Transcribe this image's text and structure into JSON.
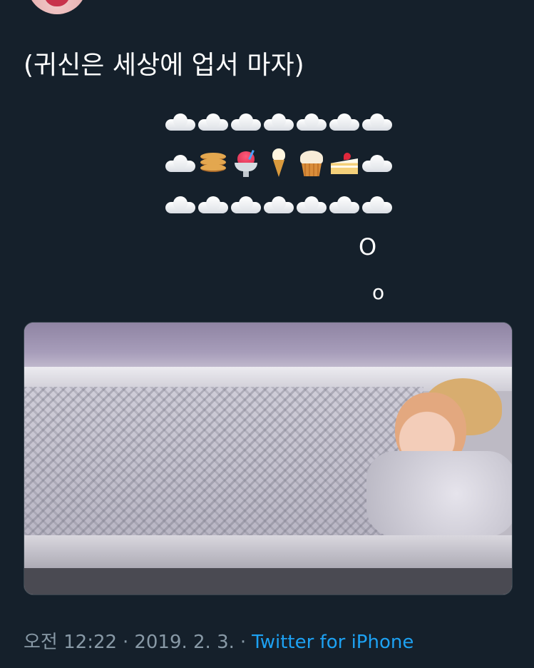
{
  "tweet": {
    "text": "(귀신은 세상에 업서 마자)",
    "emoji_rows": [
      [
        "cloud-icon",
        "cloud-icon",
        "cloud-icon",
        "cloud-icon",
        "cloud-icon",
        "cloud-icon",
        "cloud-icon"
      ],
      [
        "cloud-icon",
        "pancakes-icon",
        "shaved-ice-icon",
        "ice-cream-icon",
        "cupcake-icon",
        "shortcake-icon",
        "cloud-icon"
      ],
      [
        "cloud-icon",
        "cloud-icon",
        "cloud-icon",
        "cloud-icon",
        "cloud-icon",
        "cloud-icon",
        "cloud-icon"
      ]
    ],
    "tail_1": "O",
    "tail_2": "o",
    "media": {
      "icon": "photo-person-sleeping-under-blanket"
    },
    "meta": {
      "time": "오전 12:22",
      "separator": "·",
      "date": "2019. 2. 3.",
      "source": "Twitter for iPhone"
    }
  },
  "colors": {
    "background": "#15202b",
    "text": "#ffffff",
    "meta": "#8899a6",
    "link": "#1da1f2"
  }
}
